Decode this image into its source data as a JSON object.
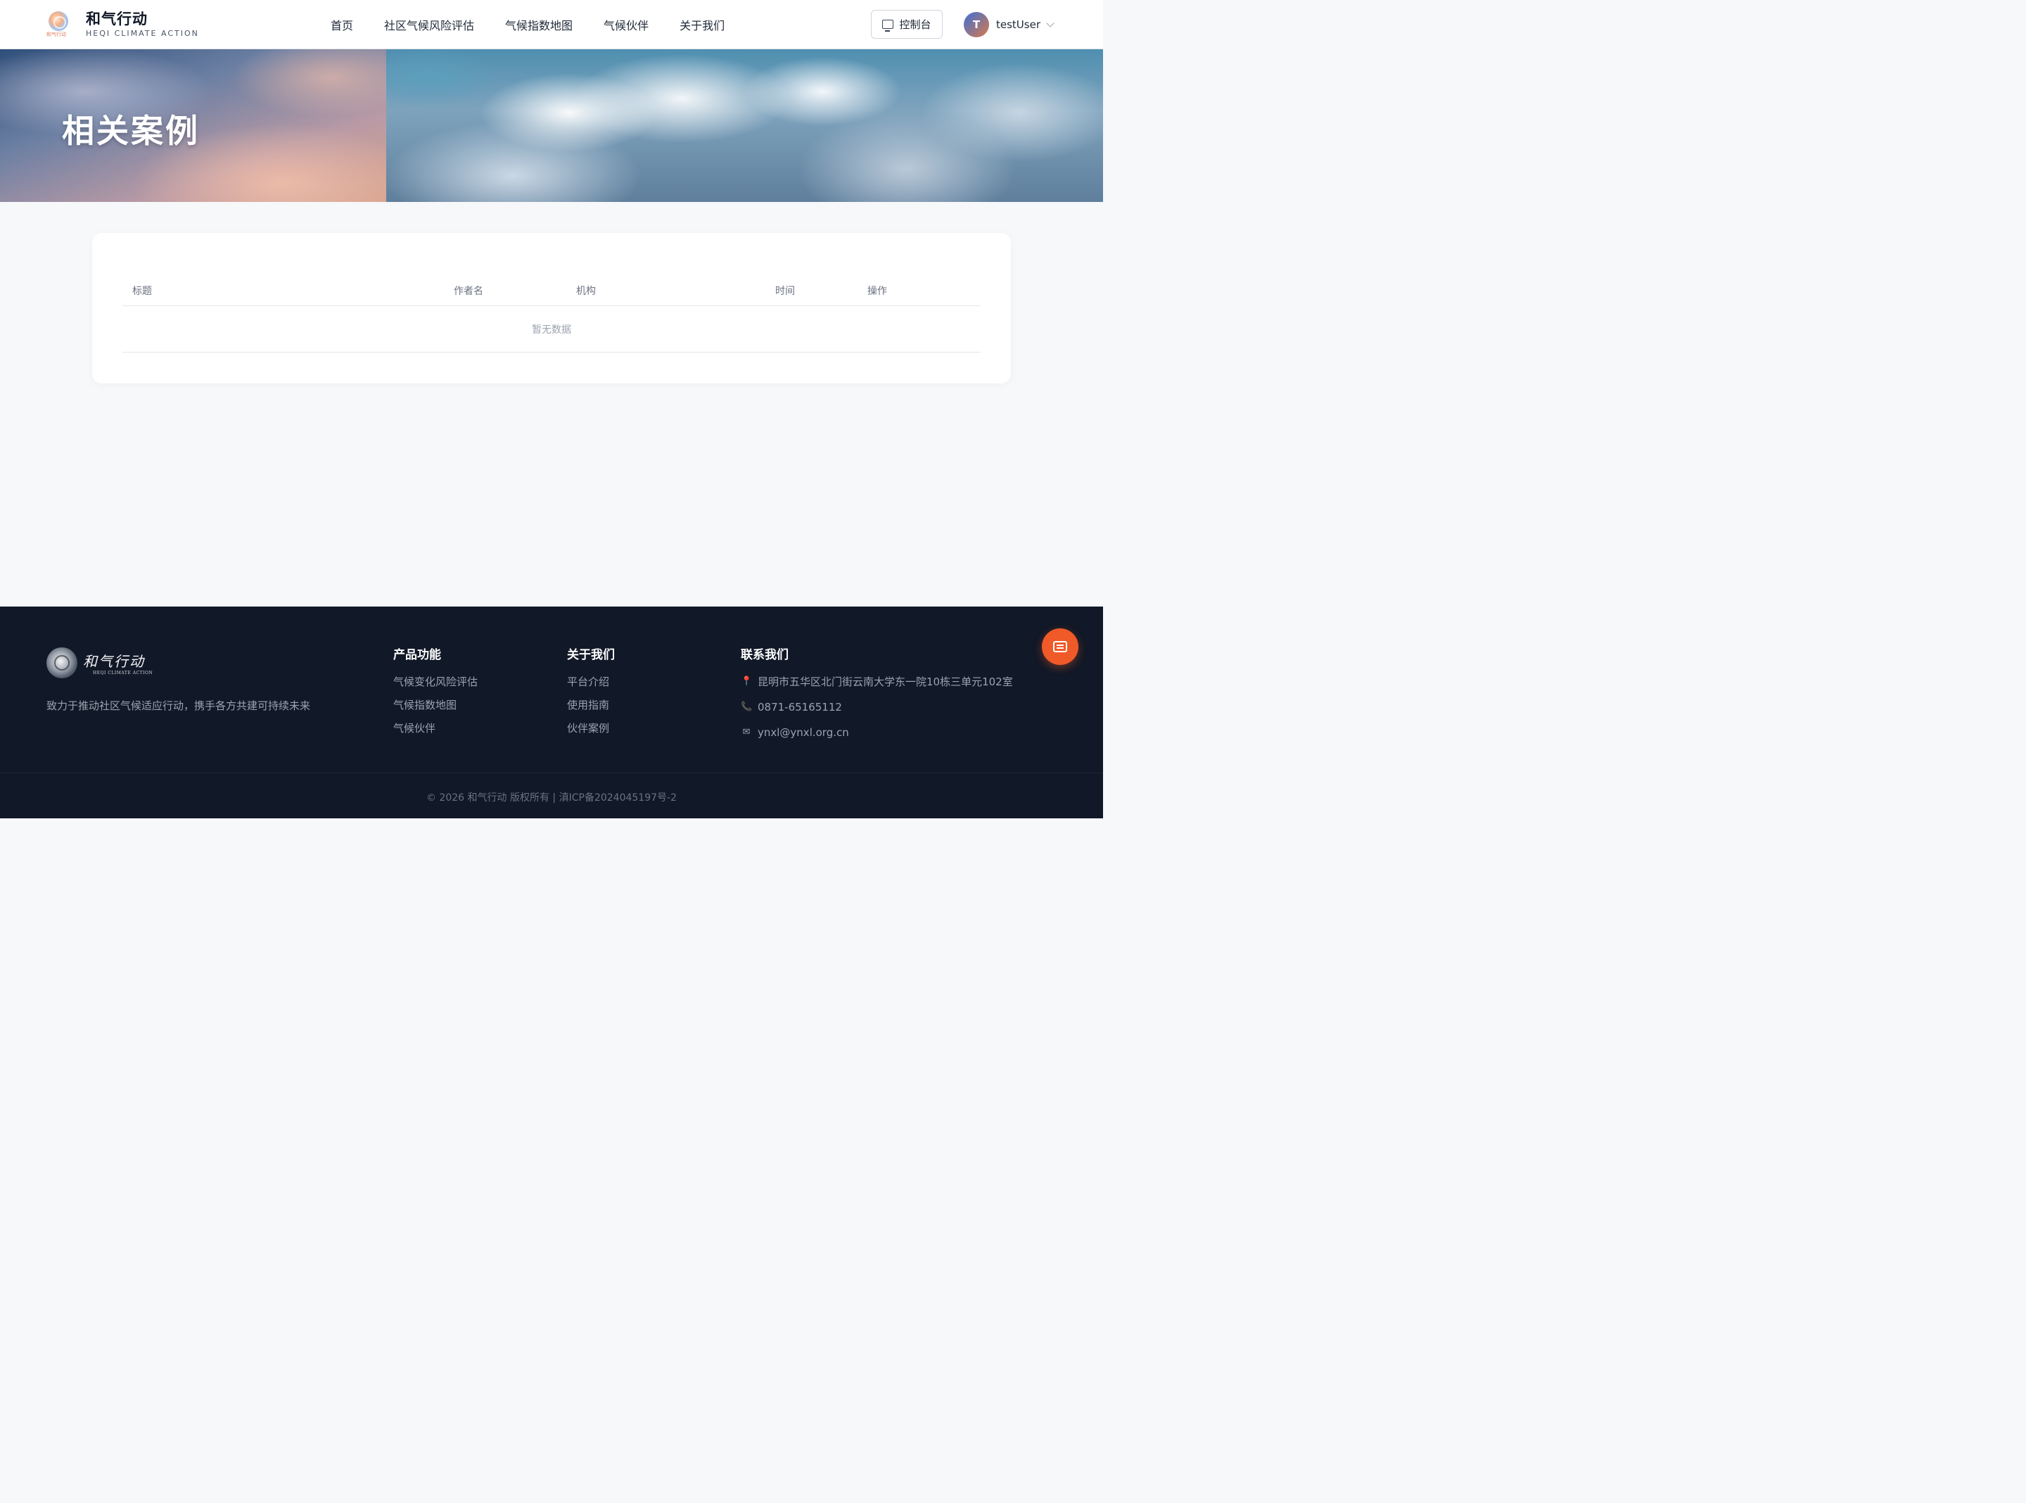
{
  "header": {
    "brand_name": "和气行动",
    "brand_sub": "HEQI CLIMATE ACTION",
    "logo_tiny": "和气行动",
    "nav": [
      "首页",
      "社区气候风险评估",
      "气候指数地图",
      "气候伙伴",
      "关于我们"
    ],
    "console_label": "控制台",
    "avatar_initial": "T",
    "username": "testUser"
  },
  "banner": {
    "title": "相关案例"
  },
  "table": {
    "columns": [
      "标题",
      "作者名",
      "机构",
      "时间",
      "操作"
    ],
    "empty_text": "暂无数据"
  },
  "footer": {
    "logo_name": "和气行动",
    "logo_sub": "HEQI CLIMATE ACTION",
    "tagline": "致力于推动社区气候适应行动，携手各方共建可持续未来",
    "products": {
      "title": "产品功能",
      "links": [
        "气候变化风险评估",
        "气候指数地图",
        "气候伙伴"
      ]
    },
    "about": {
      "title": "关于我们",
      "links": [
        "平台介绍",
        "使用指南",
        "伙伴案例"
      ]
    },
    "contact": {
      "title": "联系我们",
      "address": "昆明市五华区北门街云南大学东一院10栋三单元102室",
      "phone": "0871-65165112",
      "email": "ynxl@ynxl.org.cn"
    },
    "copyright": "© 2026 和气行动 版权所有   |   滇ICP备2024045197号-2"
  },
  "colors": {
    "accent": "#f05a28",
    "footer_bg": "#111827"
  }
}
